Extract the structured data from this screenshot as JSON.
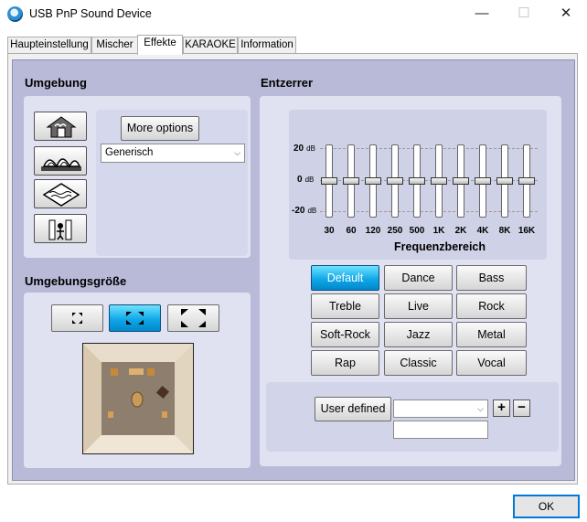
{
  "window": {
    "title": "USB PnP Sound Device",
    "minimize": "—",
    "maximize": "☐",
    "close": "✕"
  },
  "tabs": [
    "Haupteinstellung",
    "Mischer",
    "Effekte",
    "KARAOKE",
    "Information"
  ],
  "environment": {
    "title": "Umgebung",
    "more_options": "More options",
    "preset_value": "Generisch",
    "icons": [
      "house-icon",
      "concert-hall-icon",
      "underwater-icon",
      "sewer-pipe-icon"
    ]
  },
  "env_size": {
    "title": "Umgebungsgröße",
    "size_buttons": [
      "small-room",
      "medium-room",
      "large-room"
    ],
    "selected": 1
  },
  "equalizer": {
    "title": "Entzerrer",
    "db_top": "20",
    "db_mid": "0",
    "db_bot": "-20",
    "db_unit": "dB",
    "axis_label": "Frequenzbereich",
    "bands": [
      "30",
      "60",
      "120",
      "250",
      "500",
      "1K",
      "2K",
      "4K",
      "8K",
      "16K"
    ],
    "levels_db": [
      0,
      0,
      0,
      0,
      0,
      0,
      0,
      0,
      0,
      0
    ],
    "presets": [
      "Default",
      "Dance",
      "Bass",
      "Treble",
      "Live",
      "Rock",
      "Soft-Rock",
      "Jazz",
      "Metal",
      "Rap",
      "Classic",
      "Vocal"
    ],
    "active_preset": "Default",
    "user_defined": "User defined",
    "user_combo_value": "",
    "user_name_value": "",
    "add": "+",
    "remove": "−"
  },
  "ok_label": "OK",
  "colors": {
    "panel_bg": "#b9bad8",
    "active_preset": "#10a8e8",
    "ok_border": "#0078d7"
  }
}
